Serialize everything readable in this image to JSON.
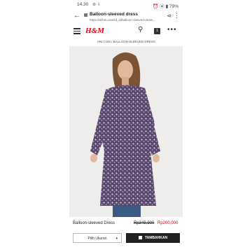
{
  "status_bar": {
    "time": "14.30",
    "battery": "79%",
    "left_icons": "⊕ ⇩",
    "right_icons": "⏰ ⦿ ▮"
  },
  "browser": {
    "page_title": "Balloon-sleeved dress",
    "url": "https://id.hm.com/id_id/balloon-sleeved-dress..."
  },
  "site": {
    "logo": "H&M",
    "bag_count": "1",
    "breadcrumb": "HM.COM  /  BALLOON-SLEEVED DRESS"
  },
  "product": {
    "name": "Balloon-sleeved Dress",
    "old_price": "Rp349,900",
    "new_price": "Rp200,000",
    "size_label": "Pilih Ukuran",
    "add_label": "TAMBAHKAN"
  },
  "colors": {
    "brand": "#e50010",
    "sale": "#d0021b",
    "button": "#222222"
  }
}
